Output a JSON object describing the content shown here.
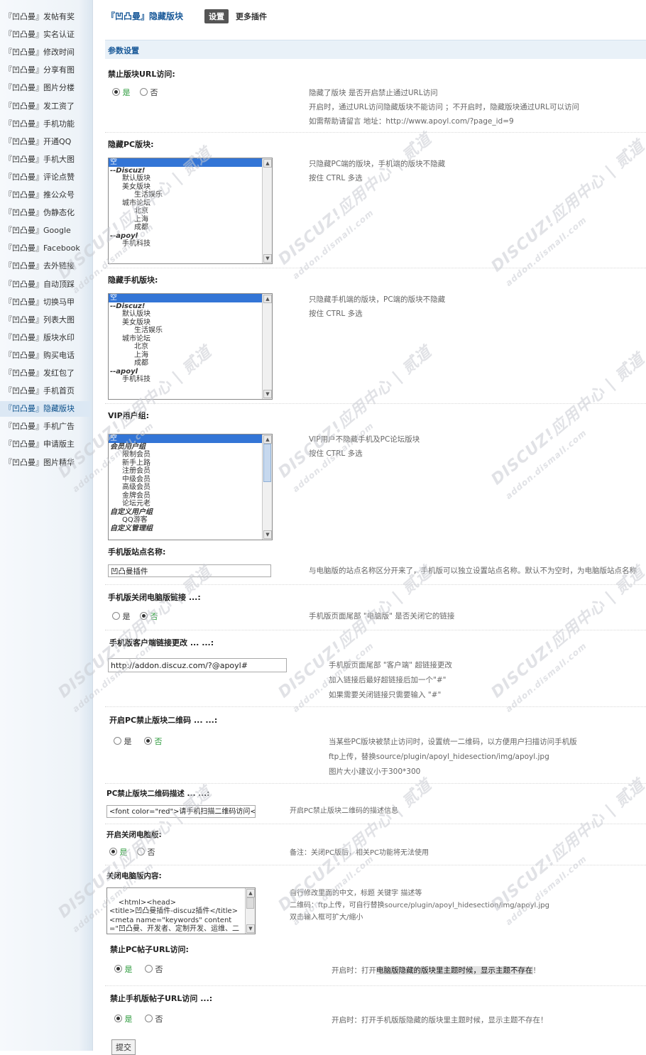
{
  "sidebar": {
    "items": [
      {
        "label": "『凹凸曼』发帖有奖",
        "active": false
      },
      {
        "label": "『凹凸曼』实名认证",
        "active": false
      },
      {
        "label": "『凹凸曼』修改时间",
        "active": false
      },
      {
        "label": "『凹凸曼』分享有图",
        "active": false
      },
      {
        "label": "『凹凸曼』图片分楼",
        "active": false
      },
      {
        "label": "『凹凸曼』发工资了",
        "active": false
      },
      {
        "label": "『凹凸曼』手机功能",
        "active": false
      },
      {
        "label": "『凹凸曼』开通QQ",
        "active": false
      },
      {
        "label": "『凹凸曼』手机大图",
        "active": false
      },
      {
        "label": "『凹凸曼』评论点赞",
        "active": false
      },
      {
        "label": "『凹凸曼』推公众号",
        "active": false
      },
      {
        "label": "『凹凸曼』伪静态化",
        "active": false
      },
      {
        "label": "『凹凸曼』Google",
        "active": false
      },
      {
        "label": "『凹凸曼』Facebook",
        "active": false
      },
      {
        "label": "『凹凸曼』去外链接",
        "active": false
      },
      {
        "label": "『凹凸曼』自动顶踩",
        "active": false
      },
      {
        "label": "『凹凸曼』切换马甲",
        "active": false
      },
      {
        "label": "『凹凸曼』列表大图",
        "active": false
      },
      {
        "label": "『凹凸曼』版块水印",
        "active": false
      },
      {
        "label": "『凹凸曼』购买电话",
        "active": false
      },
      {
        "label": "『凹凸曼』发红包了",
        "active": false
      },
      {
        "label": "『凹凸曼』手机首页",
        "active": false
      },
      {
        "label": "『凹凸曼』隐藏版块",
        "active": true
      },
      {
        "label": "『凹凸曼』手机广告",
        "active": false
      },
      {
        "label": "『凹凸曼』申请版主",
        "active": false
      },
      {
        "label": "『凹凸曼』图片精华",
        "active": false
      }
    ]
  },
  "header": {
    "plugin_title": "『凹凸曼』隐藏版块",
    "tab_settings": "设置",
    "tab_more": "更多插件"
  },
  "section_title": "参数设置",
  "watermark": "DISCUZ!应用中心 | 贰道",
  "watermark_sub": "addon.dismall.com",
  "fields": {
    "block_url": {
      "label": "禁止版块URL访问:",
      "yes": "是",
      "no": "否",
      "selected": "yes",
      "help": [
        "隐藏了版块 是否开启禁止通过URL访问",
        "开启时，通过URL访问隐藏版块不能访问 ；不开启时，隐藏版块通过URL可以访问",
        "如需帮助请留言 地址：http://www.apoyl.com/?page_id=9"
      ]
    },
    "hide_pc": {
      "label": "隐藏PC版块:",
      "options": [
        {
          "text": "空",
          "type": "opt",
          "indent": 0,
          "sel": true
        },
        {
          "text": "--Discuz!",
          "type": "grp",
          "indent": 0
        },
        {
          "text": "默认版块",
          "type": "opt",
          "indent": 1
        },
        {
          "text": "美女版块",
          "type": "opt",
          "indent": 1
        },
        {
          "text": "生活娱乐",
          "type": "opt",
          "indent": 2
        },
        {
          "text": "城市论坛",
          "type": "opt",
          "indent": 1
        },
        {
          "text": "北京",
          "type": "opt",
          "indent": 2
        },
        {
          "text": "上海",
          "type": "opt",
          "indent": 2
        },
        {
          "text": "成都",
          "type": "opt",
          "indent": 2
        },
        {
          "text": "--apoyl",
          "type": "grp",
          "indent": 0
        },
        {
          "text": "手机科技",
          "type": "opt",
          "indent": 1
        }
      ],
      "help": [
        "只隐藏PC端的版块，手机端的版块不隐藏",
        "按住 CTRL 多选"
      ]
    },
    "hide_mobile": {
      "label": "隐藏手机版块:",
      "options": [
        {
          "text": "空",
          "type": "opt",
          "indent": 0,
          "sel": true
        },
        {
          "text": "--Discuz!",
          "type": "grp",
          "indent": 0
        },
        {
          "text": "默认版块",
          "type": "opt",
          "indent": 1
        },
        {
          "text": "美女版块",
          "type": "opt",
          "indent": 1
        },
        {
          "text": "生活娱乐",
          "type": "opt",
          "indent": 2
        },
        {
          "text": "城市论坛",
          "type": "opt",
          "indent": 1
        },
        {
          "text": "北京",
          "type": "opt",
          "indent": 2
        },
        {
          "text": "上海",
          "type": "opt",
          "indent": 2
        },
        {
          "text": "成都",
          "type": "opt",
          "indent": 2
        },
        {
          "text": "--apoyl",
          "type": "grp",
          "indent": 0
        },
        {
          "text": "手机科技",
          "type": "opt",
          "indent": 1
        }
      ],
      "help": [
        "只隐藏手机端的版块，PC端的版块不隐藏",
        "按住 CTRL 多选"
      ]
    },
    "vip_groups": {
      "label": "VIP用户组:",
      "options": [
        {
          "text": "空",
          "type": "opt",
          "indent": 0,
          "sel": true
        },
        {
          "text": "会员用户组",
          "type": "grp",
          "indent": 0
        },
        {
          "text": "限制会员",
          "type": "opt",
          "indent": 1
        },
        {
          "text": "新手上路",
          "type": "opt",
          "indent": 1
        },
        {
          "text": "注册会员",
          "type": "opt",
          "indent": 1
        },
        {
          "text": "中级会员",
          "type": "opt",
          "indent": 1
        },
        {
          "text": "高级会员",
          "type": "opt",
          "indent": 1
        },
        {
          "text": "金牌会员",
          "type": "opt",
          "indent": 1
        },
        {
          "text": "论坛元老",
          "type": "opt",
          "indent": 1
        },
        {
          "text": "自定义用户组",
          "type": "grp",
          "indent": 0
        },
        {
          "text": "QQ游客",
          "type": "opt",
          "indent": 1
        },
        {
          "text": "自定义管理组",
          "type": "grp",
          "indent": 0
        }
      ],
      "help": [
        "VIP用户不隐藏手机及PC论坛版块",
        "按住 CTRL 多选"
      ]
    },
    "mobile_site_name": {
      "label": "手机版站点名称:",
      "value": "凹凸曼插件",
      "help": [
        "与电脑版的站点名称区分开来了，手机版可以独立设置站点名称。默认不为空时，为电脑版站点名称"
      ]
    },
    "mobile_close_pc_link": {
      "label": "手机版关闭电脑版链接 ...:",
      "yes": "是",
      "no": "否",
      "selected": "no",
      "help": [
        "手机版页面尾部 \"电脑版\" 是否关闭它的链接"
      ]
    },
    "mobile_client_link": {
      "label": "手机版客户端链接更改 ... ...:",
      "value": "http://addon.discuz.com/?@apoyl#",
      "help": [
        "手机版页面尾部 \"客户端\" 超链接更改",
        "加入链接后最好超链接后加一个\"#\"",
        "如果需要关闭链接只需要输入 \"#\""
      ]
    },
    "pc_qrcode": {
      "label": "开启PC禁止版块二维码 ... ...:",
      "yes": "是",
      "no": "否",
      "selected": "no",
      "help": [
        "当某些PC版块被禁止访问时，设置统一二维码，以方便用户扫描访问手机版",
        "ftp上传，替换source/plugin/apoyl_hidesection/img/apoyl.jpg",
        "图片大小建议小于300*300"
      ]
    },
    "pc_qrcode_desc": {
      "label": "PC禁止版块二维码描述 ... ...:",
      "value": "<font color=\"red\">请手机扫描二维码访问</",
      "help": [
        "开启PC禁止版块二维码的描述信息"
      ]
    },
    "close_pc": {
      "label": "开启关闭电脑版:",
      "yes": "是",
      "no": "否",
      "selected": "yes",
      "help": [
        "备注：关闭PC版后，相关PC功能将无法使用"
      ]
    },
    "close_pc_content": {
      "label": "关闭电脑版内容:",
      "value": "<html><head>\n<title>凹凸曼插件-discuz插件</title>\n<meta name=\"keywords\" content=\"凹凸曼、开发者、定制开发、运维、二次开发、模板\" />",
      "help": [
        "自行修改里面的中文，标题 关键字 描述等",
        "二维码：ftp上传，可自行替换source/plugin/apoyl_hidesection/img/apoyl.jpg",
        "双击输入框可扩大/缩小"
      ]
    },
    "pc_thread_url": {
      "label": "禁止PC帖子URL访问:",
      "yes": "是",
      "no": "否",
      "selected": "yes",
      "help_prefix": "开启时：打开",
      "help_highlight": "电脑版隐藏的版块里主题时候，显示主题不存在",
      "help_suffix": "！"
    },
    "mobile_thread_url": {
      "label": "禁止手机版帖子URL访问 ...:",
      "yes": "是",
      "no": "否",
      "selected": "yes",
      "help": [
        "开启时：打开手机版版隐藏的版块里主题时候，显示主题不存在！"
      ]
    }
  },
  "submit_label": "提交",
  "colors": {
    "accent": "#1a5a99",
    "selected_green": "#2a9a3a",
    "list_selected": "#3375d6"
  }
}
